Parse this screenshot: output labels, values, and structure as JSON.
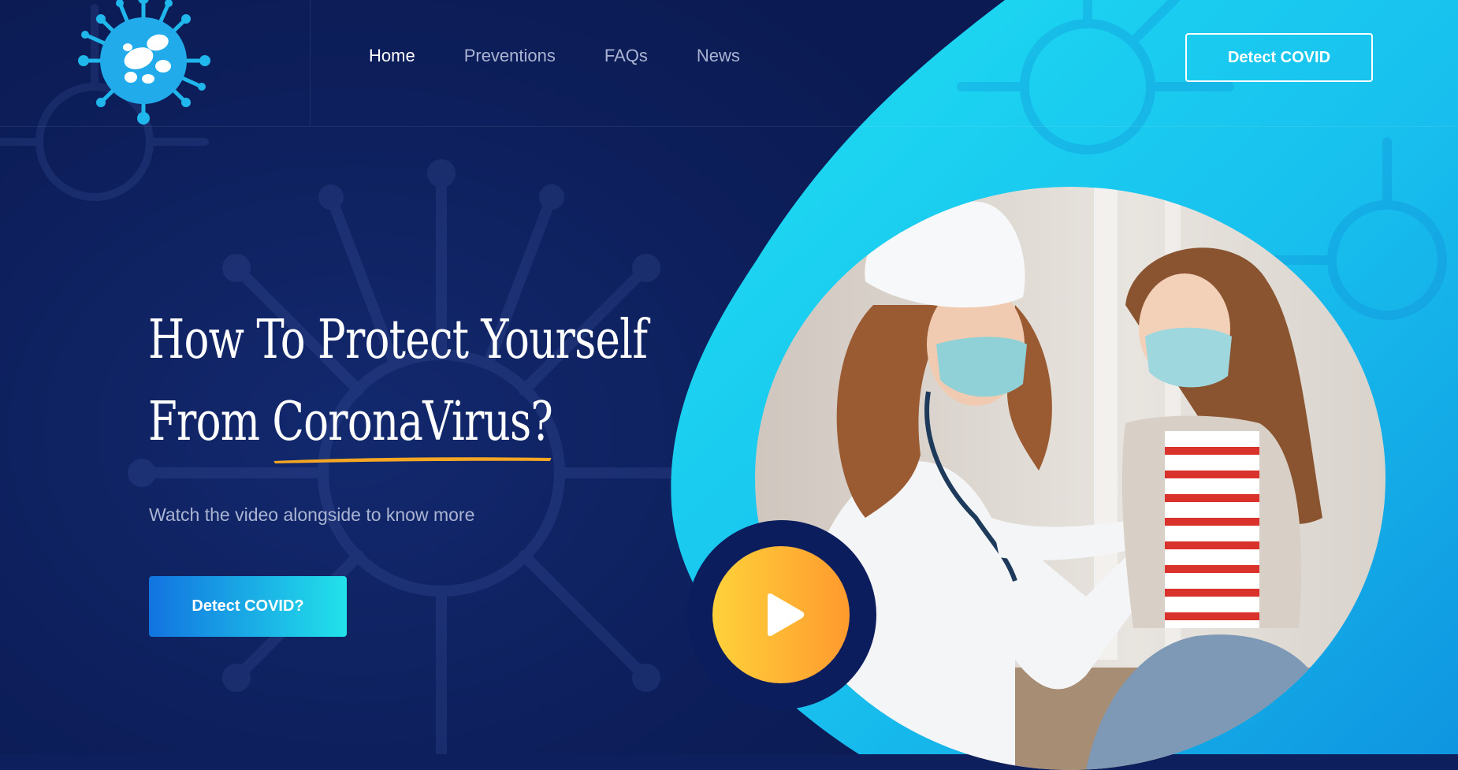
{
  "nav": {
    "items": [
      {
        "label": "Home",
        "active": true
      },
      {
        "label": "Preventions",
        "active": false
      },
      {
        "label": "FAQs",
        "active": false
      },
      {
        "label": "News",
        "active": false
      }
    ],
    "cta_label": "Detect COVID"
  },
  "hero": {
    "title_line1": "How To Protect Yourself",
    "title_line2_prefix": "From ",
    "title_line2_highlight": "CoronaVirus?",
    "subtitle": "Watch the video alongside to know more",
    "cta_label": "Detect COVID?"
  },
  "colors": {
    "background": "#0d1f5c",
    "accent_cyan": "#1fd1ef",
    "cta_gradient_start": "#1273e0",
    "cta_gradient_end": "#22e2ea",
    "play_gradient_start": "#ffd23a",
    "play_gradient_end": "#ff9a2e",
    "underline": "#f5a623"
  },
  "icons": {
    "logo": "coronavirus-logo-icon",
    "play": "play-icon"
  }
}
